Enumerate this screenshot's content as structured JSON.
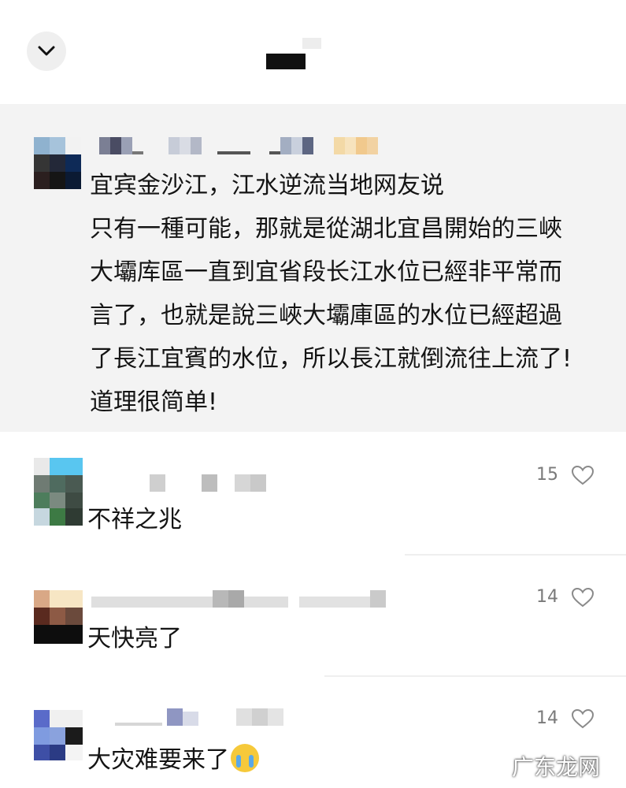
{
  "header": {
    "back_icon": "chevron-down-icon"
  },
  "post": {
    "lines": [
      "宜宾金沙江，江水逆流当地网友说",
      "只有一種可能，那就是從湖北宜昌開始的三峽",
      "大壩库區一直到宜省段长江水位已經非平常而",
      "言了，也就是說三峽大壩庫區的水位已經超過",
      "了長江宜賓的水位，所以長江就倒流往上流了!",
      "道理很简单!"
    ]
  },
  "comments": [
    {
      "text": "不祥之兆",
      "likes": "15",
      "like_icon": "heart-outline-icon"
    },
    {
      "text": "天快亮了",
      "likes": "14",
      "like_icon": "heart-outline-icon"
    },
    {
      "text": "大灾难要来了",
      "emoji": "crying-face-emoji",
      "likes": "14",
      "like_icon": "heart-outline-icon"
    }
  ],
  "watermark": "广东龙网",
  "colors": {
    "post_background": "#f3f3f3",
    "text": "#141414",
    "count_text": "#7a7a7a",
    "divider": "#efefef"
  }
}
